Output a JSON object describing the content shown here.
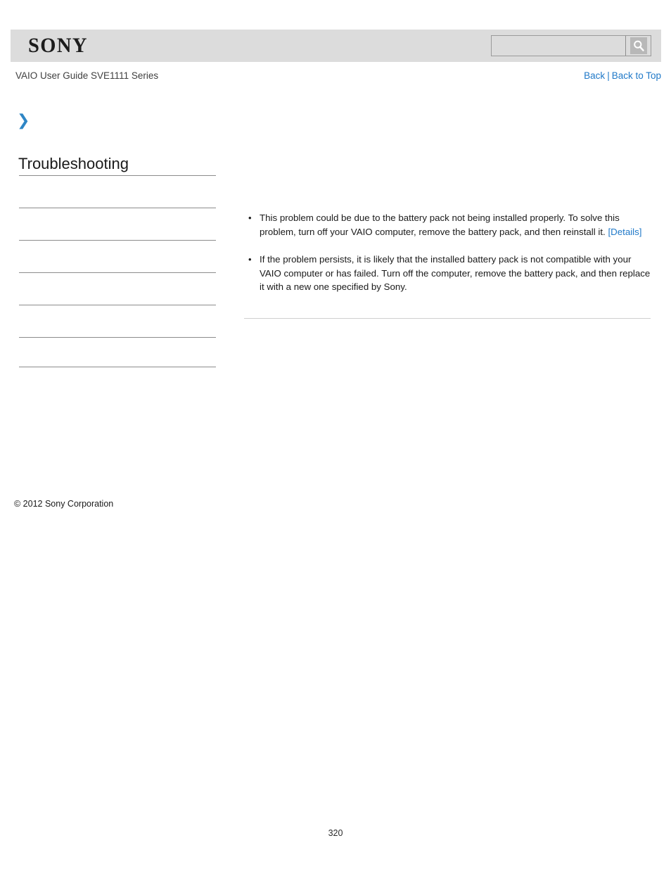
{
  "header": {
    "logo_text": "SONY",
    "search": {
      "value": "",
      "placeholder": "",
      "icon": "search-icon",
      "button_label": ""
    }
  },
  "subheader": {
    "guide_title": "VAIO User Guide SVE1111 Series",
    "links": [
      {
        "label": "Back"
      },
      {
        "label": "Back to Top"
      }
    ],
    "separator": "|"
  },
  "sidebar": {
    "chevron_icon": "chevron-right-icon",
    "section_title": "Troubleshooting",
    "menu_items": [
      {
        "label": ""
      },
      {
        "label": ""
      },
      {
        "label": ""
      },
      {
        "label": ""
      },
      {
        "label": ""
      },
      {
        "label": ""
      }
    ],
    "copyright": "© 2012 Sony Corporation"
  },
  "main": {
    "bullets": [
      {
        "text_before_link": "This problem could be due to the battery pack not being installed properly. To solve this problem, turn off your VAIO computer, remove the battery pack, and then reinstall it. ",
        "link_label": "[Details]",
        "text_after_link": ""
      },
      {
        "text_before_link": "If the problem persists, it is likely that the installed battery pack is not compatible with your VAIO computer or has failed. Turn off the computer, remove the battery pack, and then replace it with a new one specified by Sony.",
        "link_label": "",
        "text_after_link": ""
      }
    ]
  },
  "footer": {
    "page_number": "320"
  },
  "colors": {
    "link_blue": "#2079c8",
    "header_gray": "#dcdcdc",
    "rule_gray": "#8c8c8c",
    "chevron_blue": "#2e86c5"
  }
}
